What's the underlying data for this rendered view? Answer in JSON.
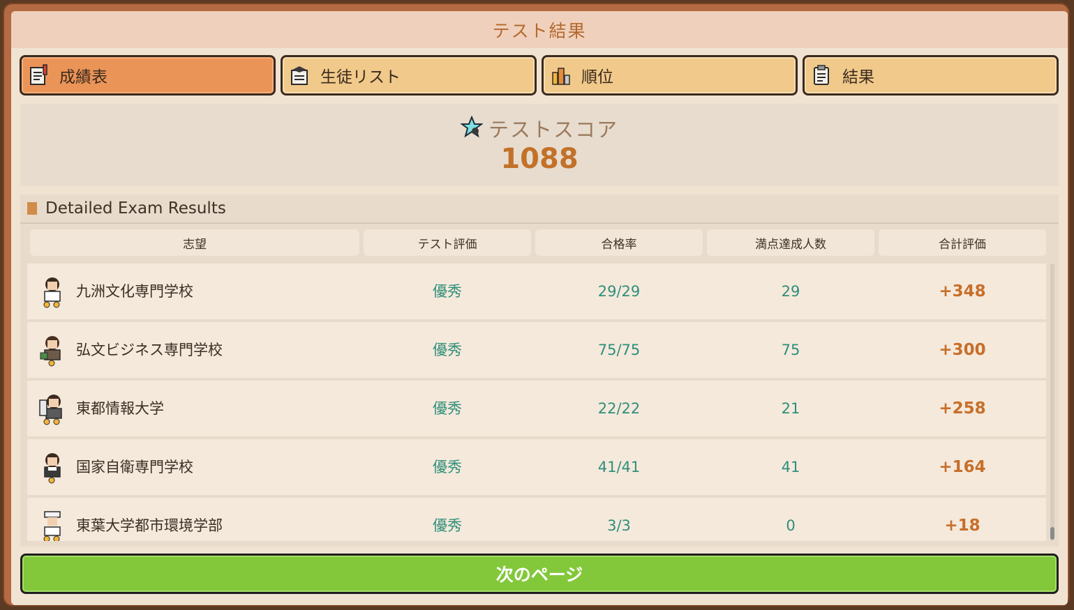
{
  "window": {
    "title": "テスト結果"
  },
  "tabs": [
    {
      "label": "成績表",
      "icon": "report-card-icon",
      "active": true
    },
    {
      "label": "生徒リスト",
      "icon": "student-list-icon",
      "active": false
    },
    {
      "label": "順位",
      "icon": "ranking-icon",
      "active": false
    },
    {
      "label": "結果",
      "icon": "results-clipboard-icon",
      "active": false
    }
  ],
  "score": {
    "label": "テストスコア",
    "value": "1088",
    "icon": "star-icon"
  },
  "results": {
    "title": "Detailed Exam Results",
    "columns": [
      "志望",
      "テスト評価",
      "合格率",
      "満点達成人数",
      "合計評価"
    ],
    "rows": [
      {
        "school": "九洲文化専門学校",
        "rating": "優秀",
        "pass_rate": "29/29",
        "perfect": "29",
        "total": "+348",
        "stars": 2
      },
      {
        "school": "弘文ビジネス専門学校",
        "rating": "優秀",
        "pass_rate": "75/75",
        "perfect": "75",
        "total": "+300",
        "stars": 1
      },
      {
        "school": "東都情報大学",
        "rating": "優秀",
        "pass_rate": "22/22",
        "perfect": "21",
        "total": "+258",
        "stars": 2
      },
      {
        "school": "国家自衛専門学校",
        "rating": "優秀",
        "pass_rate": "41/41",
        "perfect": "41",
        "total": "+164",
        "stars": 1
      },
      {
        "school": "東葉大学都市環境学部",
        "rating": "優秀",
        "pass_rate": "3/3",
        "perfect": "0",
        "total": "+18",
        "stars": 2
      }
    ]
  },
  "footer": {
    "next_label": "次のページ"
  },
  "colors": {
    "accent_orange": "#eb9458",
    "tab_bg": "#f0c98b",
    "next_green": "#82c83a",
    "value_teal": "#2e8f7a",
    "total_orange": "#c76f2a"
  }
}
